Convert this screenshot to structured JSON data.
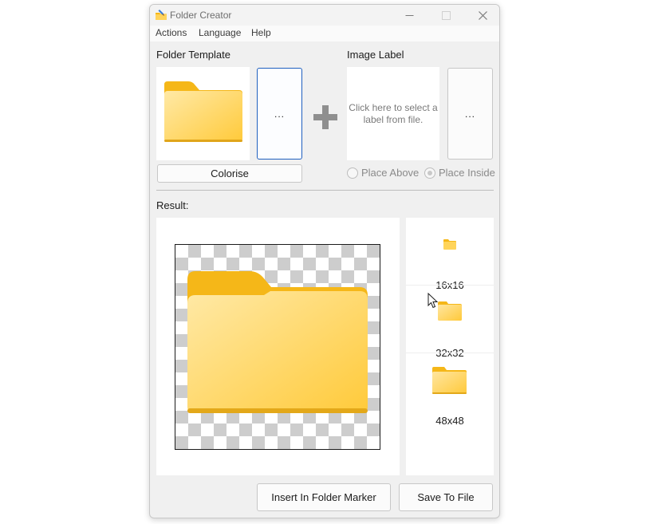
{
  "window": {
    "title": "Folder Creator",
    "controls": {
      "minimize": "—",
      "maximize": "☐",
      "close": "✕"
    }
  },
  "menu": [
    "Actions",
    "Language",
    "Help"
  ],
  "template": {
    "label": "Folder Template",
    "browse_label": "...",
    "colorise_label": "Colorise"
  },
  "image_label": {
    "label": "Image Label",
    "hint": "Click here to select a label from file.",
    "browse_label": "...",
    "place_above": "Place Above",
    "place_inside": "Place Inside",
    "selected": "place_inside"
  },
  "result": {
    "label": "Result:",
    "sizes": [
      "16x16",
      "32x32",
      "48x48"
    ]
  },
  "buttons": {
    "insert": "Insert In Folder Marker",
    "save": "Save To File"
  },
  "icons": {
    "app": "folder-brush-icon",
    "plus": "plus-icon",
    "folder": "folder-icon",
    "cursor": "mouse-pointer-icon"
  },
  "colors": {
    "folder_front_top": "#ffe9a6",
    "folder_front_bottom": "#ffca3a",
    "folder_back": "#f5b718",
    "window_bg": "#f0f0f0",
    "focus_border": "#1f5fbf"
  }
}
